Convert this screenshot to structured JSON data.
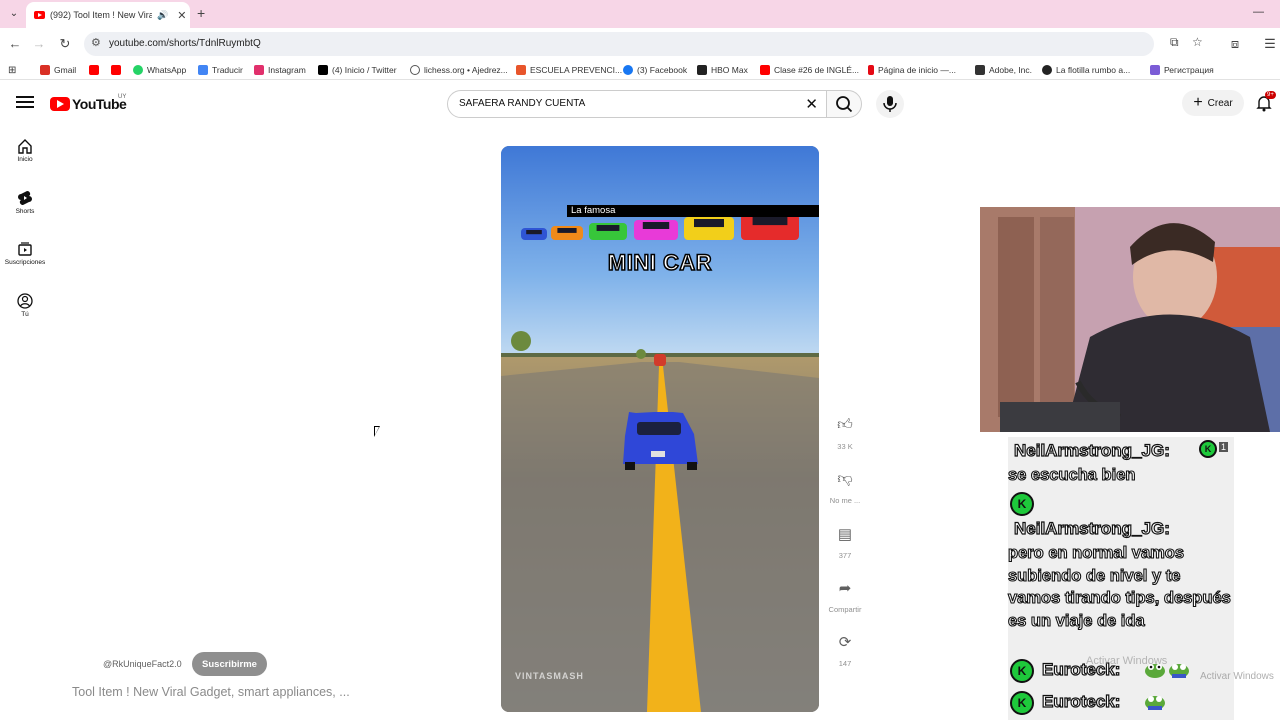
{
  "browser": {
    "tab_title": "(992) Tool Item ! New Viral",
    "url": "youtube.com/shorts/TdnlRuymbtQ",
    "bookmarks": [
      {
        "label": "Gmail",
        "color": "#d93025"
      },
      {
        "label": "",
        "color": "#ff0000"
      },
      {
        "label": "",
        "color": "#ff0000"
      },
      {
        "label": "WhatsApp",
        "color": "#25d366"
      },
      {
        "label": "Traducir",
        "color": "#4285f4"
      },
      {
        "label": "Instagram",
        "color": "#e1306c"
      },
      {
        "label": "(4) Inicio / Twitter",
        "color": "#000000"
      },
      {
        "label": "lichess.org • Ajedrez...",
        "color": "#555555"
      },
      {
        "label": "ESCUELA PREVENCI...",
        "color": "#e8552b"
      },
      {
        "label": "(3) Facebook",
        "color": "#1877f2"
      },
      {
        "label": "HBO Max",
        "color": "#222222"
      },
      {
        "label": "Clase #26 de INGLÉ...",
        "color": "#ff0000"
      },
      {
        "label": "Página de inicio —...",
        "color": "#e50914"
      },
      {
        "label": "Adobe, Inc.",
        "color": "#333333"
      },
      {
        "label": "La flotilla rumbo a...",
        "color": "#222222"
      },
      {
        "label": "Регистрация",
        "color": "#7b5cd6"
      }
    ]
  },
  "youtube": {
    "logo_text": "YouTube",
    "country_code": "UY",
    "search_value": "SAFAERA RANDY CUENTA",
    "create_label": "Crear",
    "notification_count": "9+",
    "guide": [
      {
        "label": "Inicio",
        "icon": "home-icon"
      },
      {
        "label": "Shorts",
        "icon": "shorts-icon"
      },
      {
        "label": "Suscripciones",
        "icon": "subscriptions-icon"
      },
      {
        "label": "Tú",
        "icon": "you-icon"
      }
    ]
  },
  "short": {
    "caption": "La famosa",
    "overlay_title": "MINI CAR",
    "watermark": "VINTASMASH",
    "channel": "@RkUniqueFact2.0",
    "subscribe_label": "Suscribirme",
    "title": "Tool Item ! New Viral Gadget, smart appliances, ...",
    "car_colors": [
      "#2f55d4",
      "#f08a1a",
      "#37c63a",
      "#e83ad8",
      "#f2cf1a",
      "#e52b2b"
    ],
    "actions": [
      {
        "icon": "like-icon",
        "label": "33 K"
      },
      {
        "icon": "dislike-icon",
        "label": "No me ..."
      },
      {
        "icon": "comment-icon",
        "label": "377"
      },
      {
        "icon": "share-icon",
        "label": "Compartir"
      },
      {
        "icon": "remix-icon",
        "label": "147"
      }
    ]
  },
  "chat": {
    "user1": "NeilArmstrong_JG:",
    "msg1": "se escucha bien",
    "user2": "NeilArmstrong_JG:",
    "msg2": "pero en normal vamos subiendo de nivel y te vamos tirando tips, después es un viaje de ida",
    "user3": "Euroteck:",
    "user4": "Euroteck:",
    "badge_count": "1"
  },
  "os_watermark": {
    "line1": "Activar Windows",
    "line2": "Activar Windows"
  }
}
